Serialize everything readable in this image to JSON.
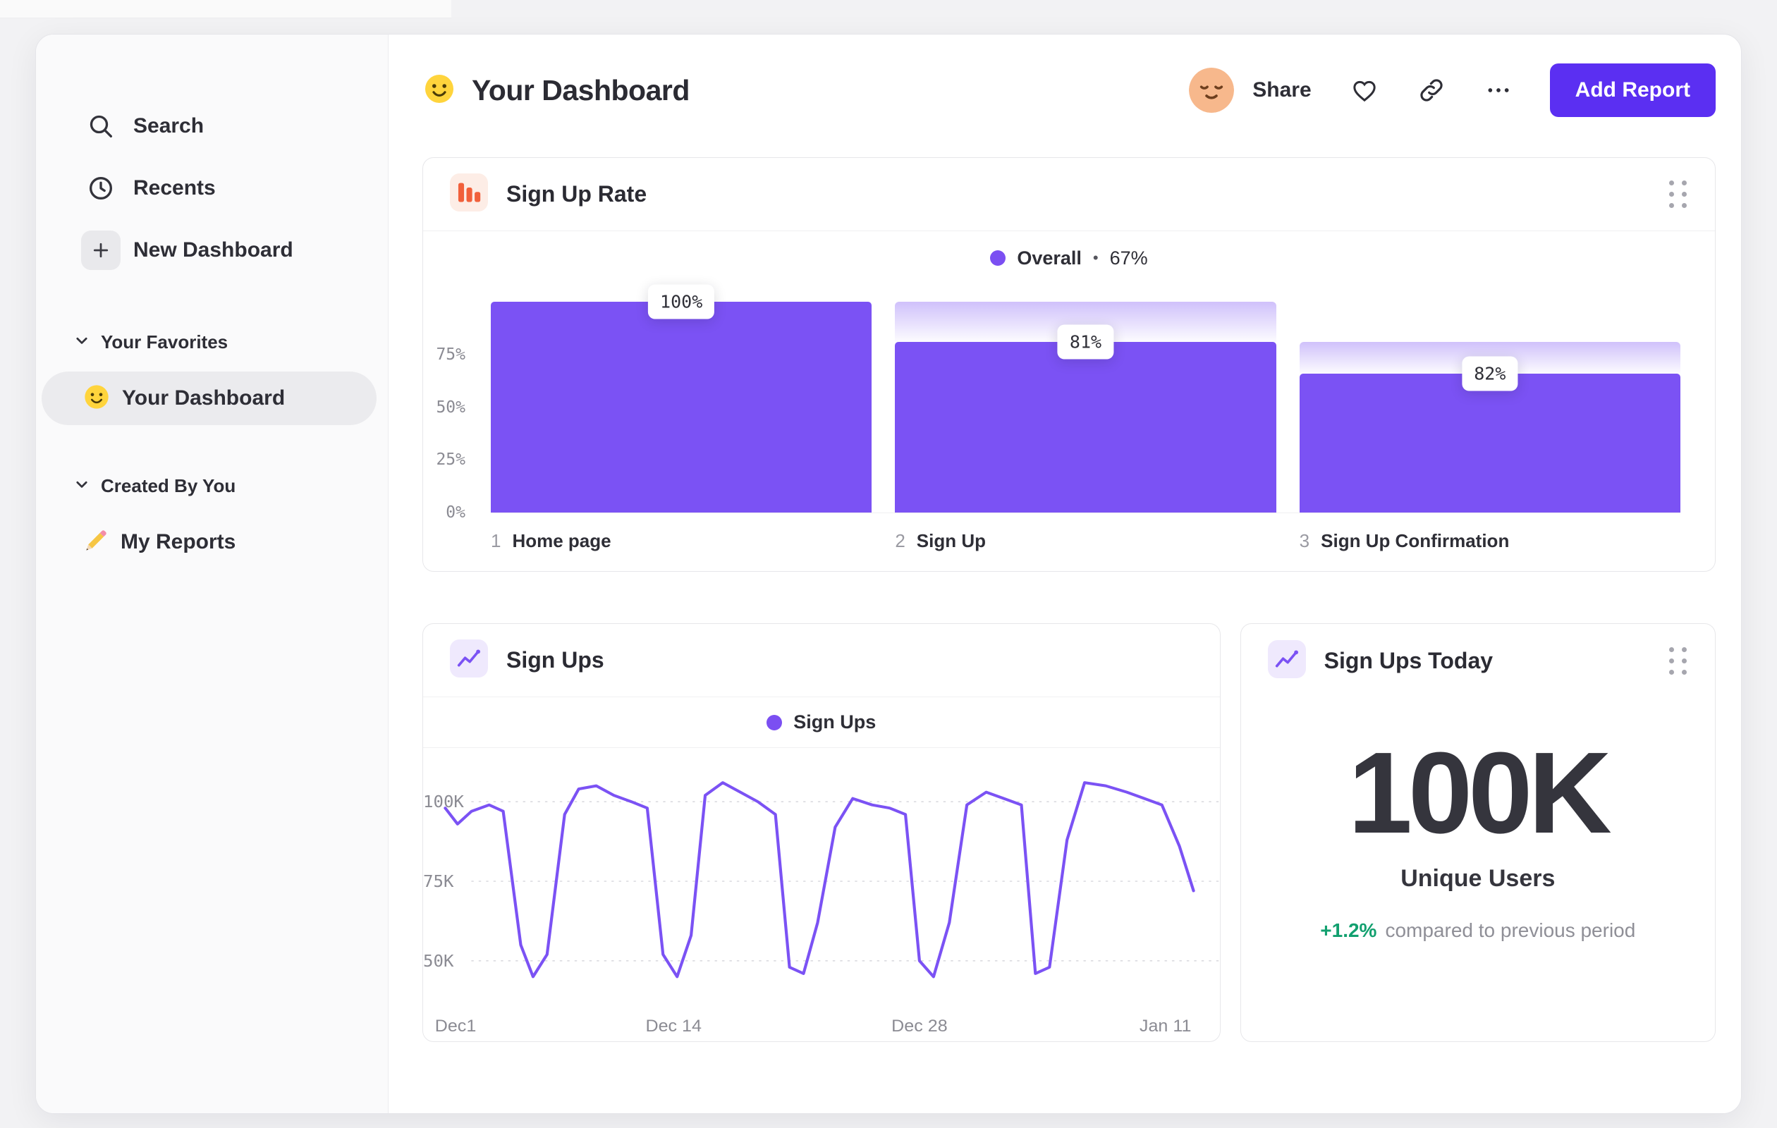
{
  "sidebar": {
    "nav": [
      {
        "label": "Search"
      },
      {
        "label": "Recents"
      },
      {
        "label": "New Dashboard"
      }
    ],
    "sections": [
      {
        "title": "Your Favorites",
        "items": [
          {
            "label": "Your Dashboard",
            "selected": true
          }
        ]
      },
      {
        "title": "Created By You",
        "items": [
          {
            "label": "My Reports",
            "selected": false
          }
        ]
      }
    ]
  },
  "header": {
    "title": "Your Dashboard",
    "share": "Share",
    "add_report": "Add Report"
  },
  "chart_data": [
    {
      "type": "bar",
      "subtype": "funnel",
      "title": "Sign Up Rate",
      "legend": {
        "label": "Overall",
        "separator": "•",
        "value": "67%"
      },
      "xlabel": "",
      "ylabel": "",
      "ylim": [
        0,
        100
      ],
      "grid": false,
      "bar_color": "#7B52F4",
      "steps": [
        {
          "index": "1",
          "name": "Home page",
          "conversion_label": "100%",
          "absolute_pct": 100
        },
        {
          "index": "2",
          "name": "Sign Up",
          "conversion_label": "81%",
          "absolute_pct": 81
        },
        {
          "index": "3",
          "name": "Sign Up Confirmation",
          "conversion_label": "82%",
          "absolute_pct": 66
        }
      ],
      "y_ticks": [
        {
          "label": "75%",
          "value": 75
        },
        {
          "label": "50%",
          "value": 50
        },
        {
          "label": "25%",
          "value": 25
        },
        {
          "label": "0%",
          "value": 0
        }
      ]
    },
    {
      "type": "line",
      "title": "Sign Ups",
      "legend": "Sign Ups",
      "xlabel": "",
      "ylabel": "",
      "unit": "K",
      "line_color": "#7B52F4",
      "grid": "dotted-horizontal",
      "xlim": [
        0,
        43.5
      ],
      "ylim": [
        38,
        112
      ],
      "x_ticks": [
        {
          "label": "Dec1",
          "day": 0
        },
        {
          "label": "Dec 14",
          "day": 13
        },
        {
          "label": "Dec 28",
          "day": 27
        },
        {
          "label": "Jan 11",
          "day": 41
        }
      ],
      "y_ticks": [
        {
          "label": "100K",
          "value": 100
        },
        {
          "label": "75K",
          "value": 75
        },
        {
          "label": "50K",
          "value": 50
        }
      ],
      "points": [
        [
          0,
          98
        ],
        [
          0.7,
          93
        ],
        [
          1.5,
          97
        ],
        [
          2.5,
          99
        ],
        [
          3.3,
          97
        ],
        [
          4.3,
          55
        ],
        [
          5,
          45
        ],
        [
          5.8,
          52
        ],
        [
          6.8,
          96
        ],
        [
          7.6,
          104
        ],
        [
          8.6,
          105
        ],
        [
          9.6,
          102
        ],
        [
          10.6,
          100
        ],
        [
          11.5,
          98
        ],
        [
          12.4,
          52
        ],
        [
          13.2,
          45
        ],
        [
          14,
          58
        ],
        [
          14.8,
          102
        ],
        [
          15.8,
          106
        ],
        [
          16.8,
          103
        ],
        [
          17.8,
          100
        ],
        [
          18.8,
          96
        ],
        [
          19.6,
          48
        ],
        [
          20.4,
          46
        ],
        [
          21.2,
          62
        ],
        [
          22.2,
          92
        ],
        [
          23.2,
          101
        ],
        [
          24.3,
          99
        ],
        [
          25.3,
          98
        ],
        [
          26.2,
          96
        ],
        [
          27,
          50
        ],
        [
          27.8,
          45
        ],
        [
          28.7,
          62
        ],
        [
          29.7,
          99
        ],
        [
          30.8,
          103
        ],
        [
          31.8,
          101
        ],
        [
          32.8,
          99
        ],
        [
          33.6,
          46
        ],
        [
          34.4,
          48
        ],
        [
          35.4,
          88
        ],
        [
          36.4,
          106
        ],
        [
          37.6,
          105
        ],
        [
          38.8,
          103
        ],
        [
          39.8,
          101
        ],
        [
          40.8,
          99
        ],
        [
          41.8,
          86
        ],
        [
          42.6,
          72
        ]
      ]
    },
    {
      "type": "kpi",
      "title": "Sign Ups Today",
      "value": "100K",
      "label": "Unique Users",
      "delta": "+1.2%",
      "delta_direction": "up",
      "note": "compared to previous period"
    }
  ],
  "colors": {
    "accent_purple": "#7B52F4",
    "button_purple": "#5B2FF2",
    "icon_orange": "#F1603B",
    "delta_green": "#12A06F"
  }
}
